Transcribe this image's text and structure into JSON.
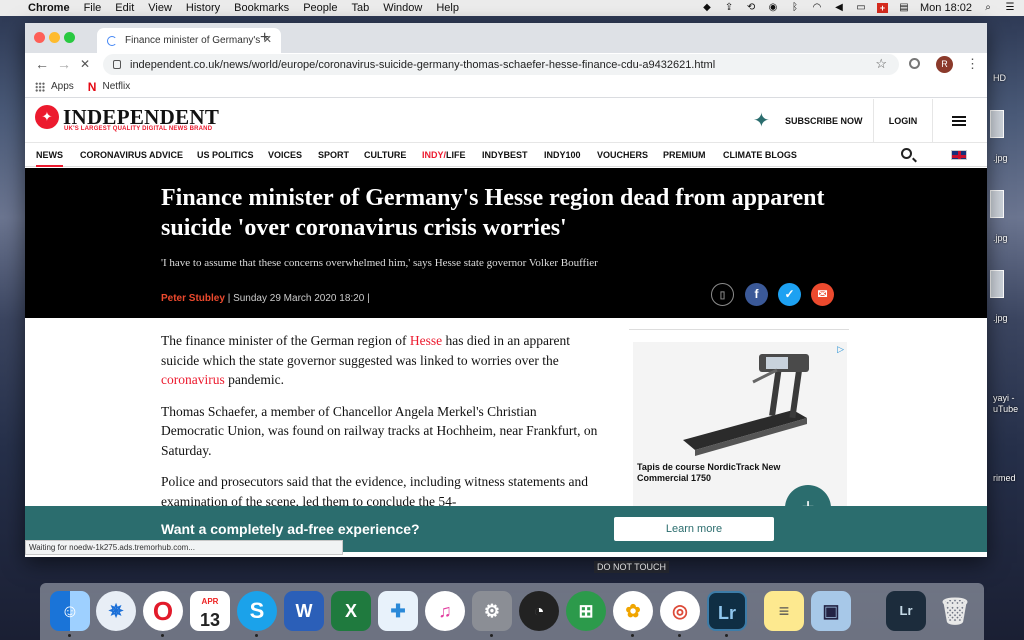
{
  "menubar": {
    "apple": "",
    "items": [
      "Chrome",
      "File",
      "Edit",
      "View",
      "History",
      "Bookmarks",
      "People",
      "Tab",
      "Window",
      "Help"
    ],
    "clock": "Mon 18:02"
  },
  "desktop": {
    "labels": [
      "HD",
      ".jpg",
      ".jpg",
      ".jpg",
      "yayi -",
      "uTube",
      "rimed"
    ]
  },
  "browser": {
    "tab_title": "Finance minister of Germany's",
    "url": "independent.co.uk/news/world/europe/coronavirus-suicide-germany-thomas-schaefer-hesse-finance-cdu-a9432621.html",
    "bookmarks": [
      "Apps",
      "Netflix"
    ],
    "profile_initial": "R",
    "status": "Waiting for noedw-1k275.ads.tremorhub.com..."
  },
  "site": {
    "logo": "INDEPENDENT",
    "tagline": "UK'S LARGEST QUALITY DIGITAL NEWS BRAND",
    "subscribe": "SUBSCRIBE NOW",
    "login": "LOGIN",
    "nav": {
      "news": "NEWS",
      "coronavirus": "CORONAVIRUS ADVICE",
      "uspolitics": "US POLITICS",
      "voices": "VOICES",
      "sport": "SPORT",
      "culture": "CULTURE",
      "indy": "INDY/",
      "life": "LIFE",
      "indybest": "INDYBEST",
      "indy100": "INDY100",
      "vouchers": "VOUCHERS",
      "premium": "PREMIUM",
      "climate": "CLIMATE BLOGS"
    }
  },
  "article": {
    "headline": "Finance minister of Germany's Hesse region dead from apparent suicide 'over coronavirus crisis worries'",
    "standfirst": "'I have to assume that these concerns overwhelmed him,' says Hesse state governor Volker Bouffier",
    "author": "Peter Stubley",
    "date": "| Sunday 29 March 2020 18:20 |",
    "p1_a": "The finance minister of the German region of ",
    "p1_link1": "Hesse",
    "p1_b": " has died in an apparent suicide which the state governor suggested was linked to worries over the ",
    "p1_link2": "coronavirus",
    "p1_c": " pandemic.",
    "p2": "Thomas Schaefer, a member of Chancellor Angela Merkel's Christian Democratic Union, was found on railway tracks at Hochheim, near Frankfurt, on Saturday.",
    "p3": "Police and prosecutors said that the evidence, including witness statements and examination of the scene, led them to conclude the 54-"
  },
  "ad": {
    "caption": "Tapis de course NordicTrack New Commercial 1750"
  },
  "adfree": {
    "text": "Want a completely ad-free experience?",
    "button": "Learn more"
  },
  "dnt": "DO NOT TOUCH",
  "dock": {
    "calendar_month": "APR",
    "calendar_day": "13"
  }
}
